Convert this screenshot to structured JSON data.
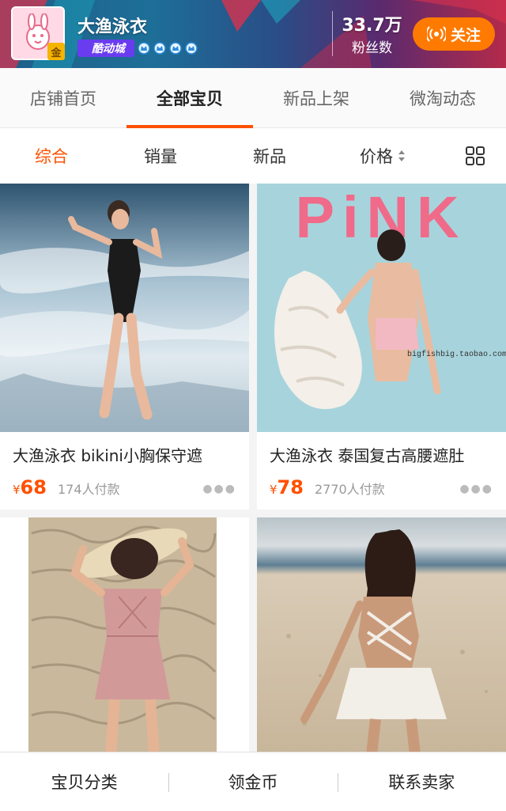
{
  "shop": {
    "name": "大渔泳衣",
    "logo_badge": "金",
    "level_badge": "酷动城",
    "fans_count": "33.7万",
    "fans_label": "粉丝数",
    "follow_label": "关注"
  },
  "tabs": [
    {
      "label": "店铺首页",
      "active": false
    },
    {
      "label": "全部宝贝",
      "active": true
    },
    {
      "label": "新品上架",
      "active": false
    },
    {
      "label": "微淘动态",
      "active": false
    }
  ],
  "sort": {
    "comprehensive": "综合",
    "sales": "销量",
    "new": "新品",
    "price": "价格"
  },
  "products": [
    {
      "title": "大渔泳衣 bikini小胸保守遮",
      "currency": "¥",
      "price": "68",
      "sold": "174人付款"
    },
    {
      "title": "大渔泳衣 泰国复古高腰遮肚",
      "currency": "¥",
      "price": "78",
      "sold": "2770人付款"
    },
    {
      "title": "",
      "currency": "",
      "price": "",
      "sold": ""
    },
    {
      "title": "",
      "currency": "",
      "price": "",
      "sold": ""
    }
  ],
  "product_image_text": {
    "pink_title": "PiNK",
    "watermark": "bigfishbig.taobao.com"
  },
  "bottom_bar": {
    "category": "宝贝分类",
    "coins": "领金币",
    "contact": "联系卖家"
  },
  "colors": {
    "accent": "#ff5000",
    "follow": "#ff7a00",
    "level_badge": "#6a3cf0"
  }
}
